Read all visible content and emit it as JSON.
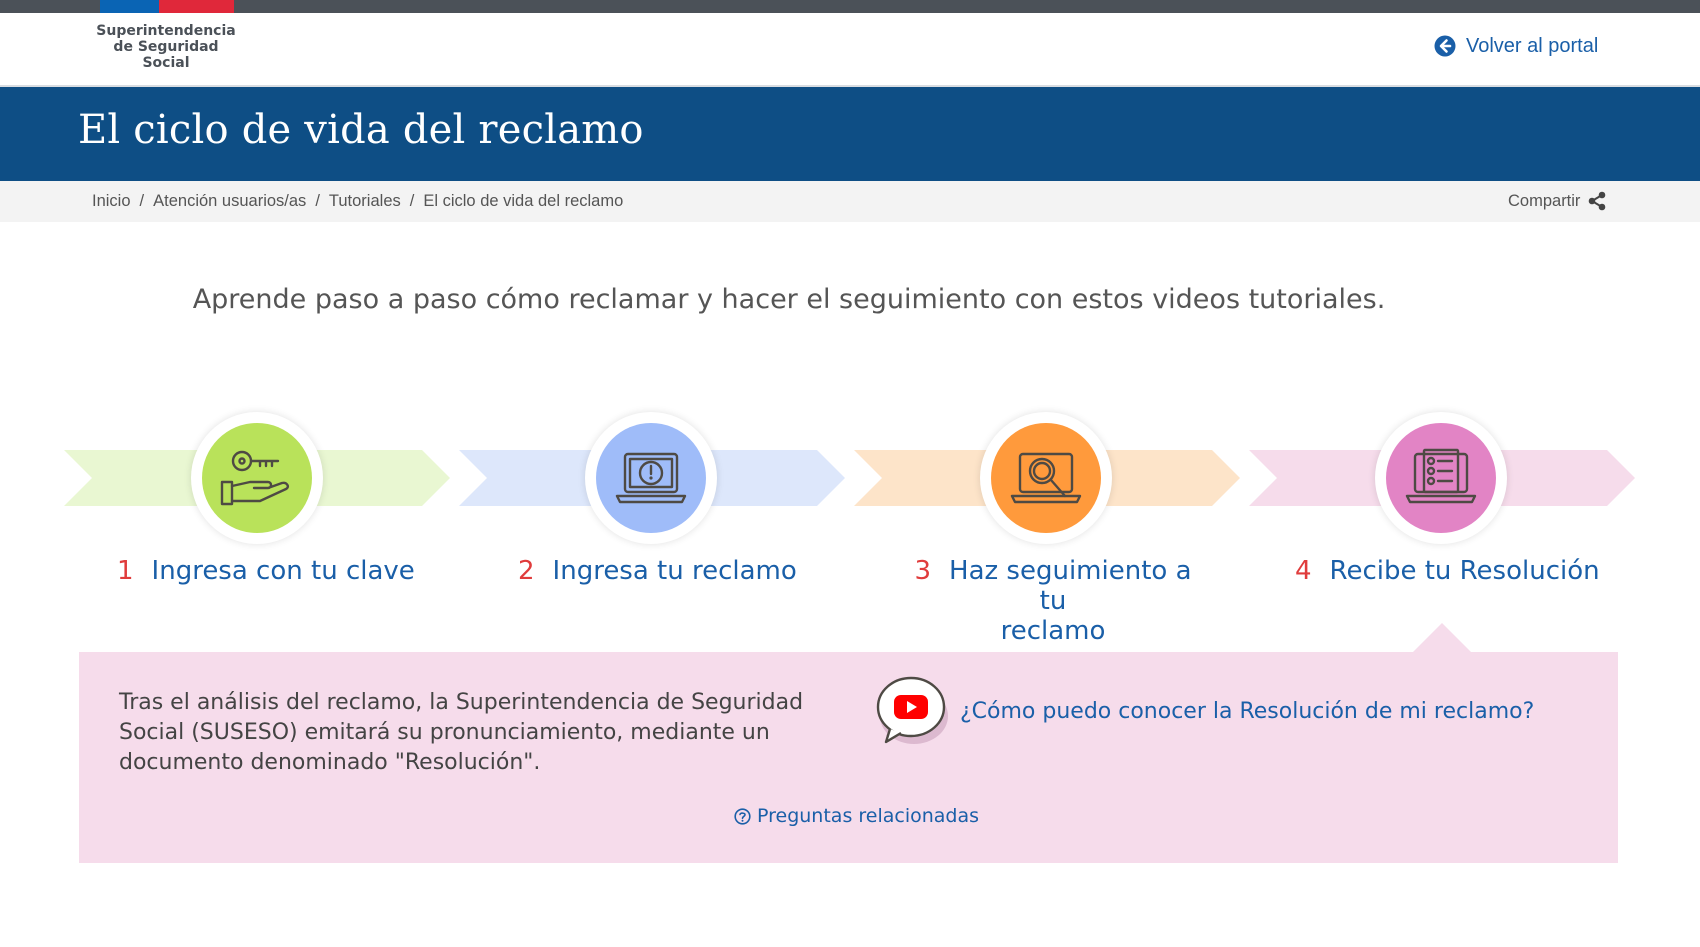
{
  "org": {
    "logo_lines": [
      "Superintendencia",
      "de Seguridad",
      "Social"
    ]
  },
  "header": {
    "back_label": "Volver al portal"
  },
  "banner": {
    "title": "El ciclo de vida del reclamo"
  },
  "breadcrumb": {
    "items": [
      "Inicio",
      "Atención usuarios/as",
      "Tutoriales"
    ],
    "current": "El ciclo de vida del reclamo",
    "share_label": "Compartir"
  },
  "intro": "Aprende paso a paso cómo reclamar y hacer el seguimiento con estos videos tutoriales.",
  "steps": [
    {
      "num": "1",
      "label": "Ingresa con tu clave",
      "color": "#b9e25a",
      "band": "#e9f7d2",
      "icon": "key-hand-icon"
    },
    {
      "num": "2",
      "label": "Ingresa tu reclamo",
      "color": "#9fbcf9",
      "band": "#dde7fb",
      "icon": "laptop-alert-icon"
    },
    {
      "num": "3",
      "label_line1": "Haz seguimiento a tu",
      "label_line2": "reclamo",
      "color": "#ff9a3c",
      "band": "#fde4c9",
      "icon": "laptop-search-icon"
    },
    {
      "num": "4",
      "label": "Recibe tu Resolución",
      "color": "#e284c5",
      "band": "#f6dceb",
      "icon": "laptop-checklist-icon"
    }
  ],
  "panel": {
    "text": "Tras el análisis del reclamo, la Superintendencia de Seguridad Social (SUSESO) emitará su pronunciamiento, mediante un documento denominado \"Resolución\".",
    "video_label": "¿Cómo puedo conocer la Resolución de mi reclamo?",
    "related_label": "Preguntas relacionadas"
  },
  "colors": {
    "primary": "#0e4e85",
    "link": "#1a5fa8",
    "number": "#e03c3c"
  }
}
